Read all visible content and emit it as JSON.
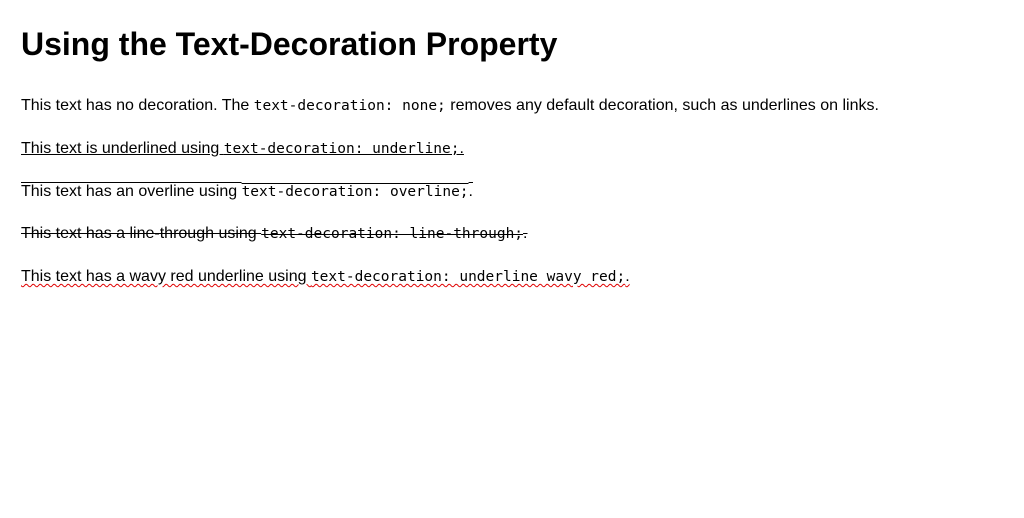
{
  "page": {
    "title": "Using the Text-Decoration Property"
  },
  "paragraphs": [
    {
      "before": "This text has no decoration. The ",
      "code": "text-decoration: none;",
      "after": " removes any default decoration, such as underlines on links.",
      "decoration": "none"
    },
    {
      "before": "This text is underlined using ",
      "code": "text-decoration: underline;",
      "after": ".",
      "decoration": "underline"
    },
    {
      "before": "This text has an overline using ",
      "code": "text-decoration: overline;",
      "after": ".",
      "decoration": "overline"
    },
    {
      "before": "This text has a line-through using ",
      "code": "text-decoration: line-through;",
      "after": ".",
      "decoration": "line-through"
    },
    {
      "before": "This text has a wavy red underline using ",
      "code": "text-decoration: underline wavy red;",
      "after": ".",
      "decoration": "underline wavy red",
      "decoration_color": "#e00000"
    }
  ]
}
